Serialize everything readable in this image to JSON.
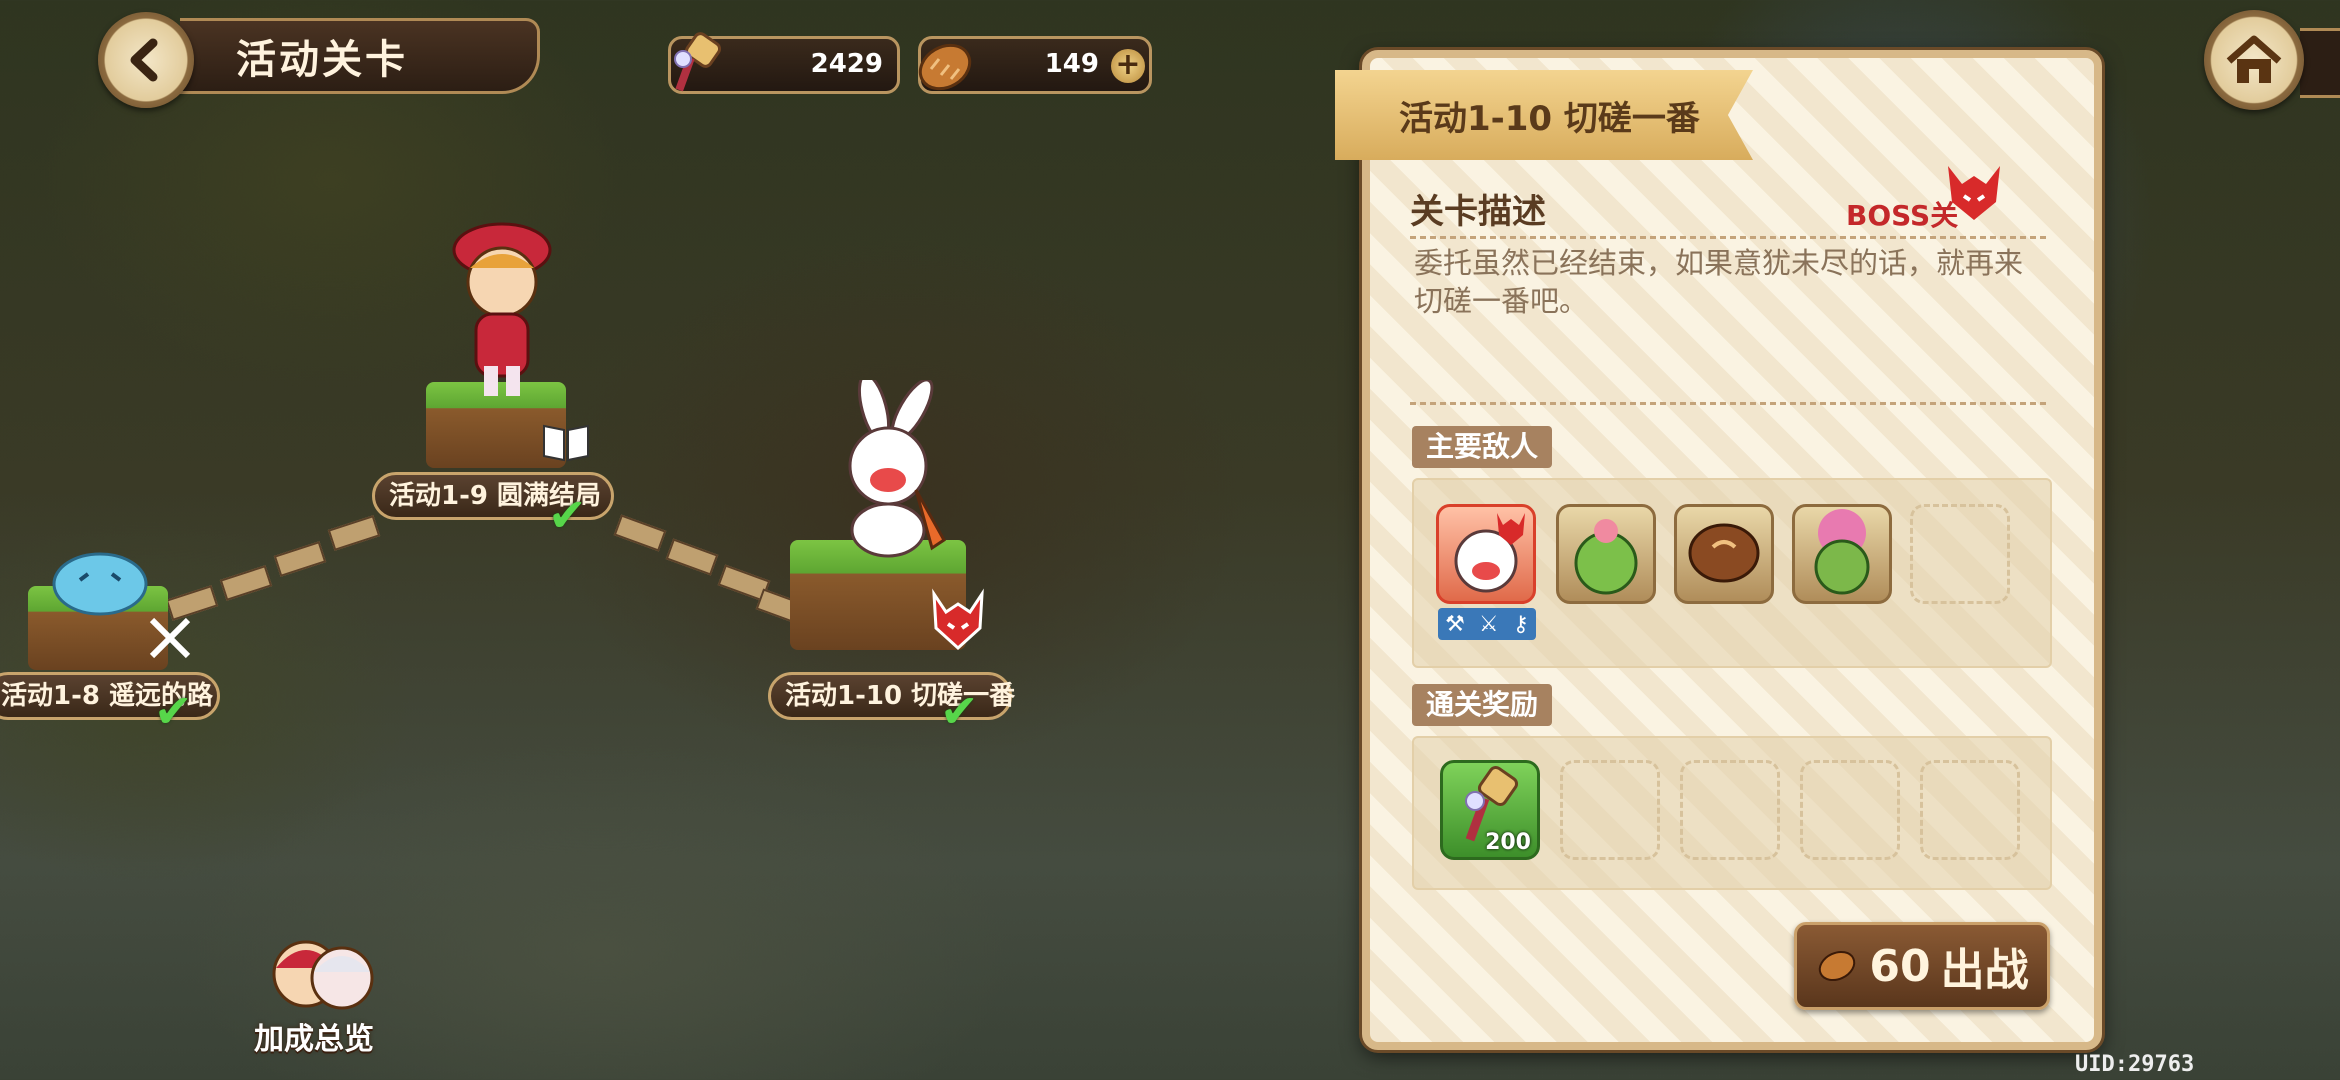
{
  "header": {
    "title": "活动关卡"
  },
  "resources": [
    {
      "icon": "hammer-ticket-icon",
      "value": "2429"
    },
    {
      "icon": "bread-icon",
      "value": "149"
    }
  ],
  "map": {
    "nodes": [
      {
        "label": "活动1-8 遥远的路",
        "cleared": true,
        "icon": "crossed-swords-icon"
      },
      {
        "label": "活动1-9 圆满结局",
        "cleared": true,
        "icon": "book-icon"
      },
      {
        "label": "活动1-10 切磋一番",
        "cleared": true,
        "icon": "boss-demon-icon"
      }
    ],
    "bonus_label": "加成总览"
  },
  "panel": {
    "stage_title": "活动1-10 切磋一番",
    "desc_heading": "关卡描述",
    "boss_tag": "BOSS关",
    "description": "委托虽然已经结束，如果意犹未尽的话，就再来切磋一番吧。",
    "enemies_tag": "主要敌人",
    "enemies": [
      "rabbit-boss",
      "leaf-sprite",
      "mushroom",
      "flower-goblin"
    ],
    "rewards_tag": "通关奖励",
    "reward": {
      "icon": "hammer-ticket-icon",
      "count": "200"
    },
    "fight_cost": "60",
    "fight_label": "出战"
  },
  "uid": "UID:29763",
  "colors": {
    "accent": "#d7b888",
    "boss": "#d9402a",
    "check": "#57d64a"
  }
}
